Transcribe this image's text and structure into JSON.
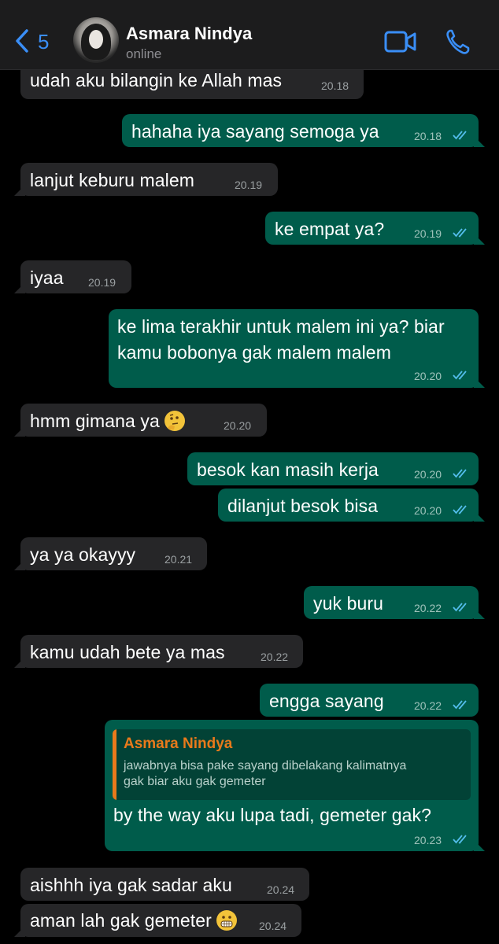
{
  "header": {
    "back_count": "5",
    "contact_name": "Asmara Nindya",
    "status": "online"
  },
  "colors": {
    "accent": "#3a8ef6",
    "outgoing": "#005c4b",
    "incoming": "#262628",
    "quote_name": "#e97a1b"
  },
  "messages": [
    {
      "text": "udah aku bilangin ke Allah mas",
      "time": "20.18",
      "dir": "in"
    },
    {
      "text": "hahaha iya sayang semoga ya",
      "time": "20.18",
      "dir": "out",
      "status": "read"
    },
    {
      "text": "lanjut keburu malem",
      "time": "20.19",
      "dir": "in"
    },
    {
      "text": "ke empat ya?",
      "time": "20.19",
      "dir": "out",
      "status": "read"
    },
    {
      "text": "iyaa",
      "time": "20.19",
      "dir": "in"
    },
    {
      "text_line1": "ke lima terakhir untuk malem ini ya? biar",
      "text_line2": "kamu bobonya gak malem malem",
      "time": "20.20",
      "dir": "out",
      "status": "read"
    },
    {
      "text": "hmm gimana ya",
      "emoji": "thinking-face-emoji",
      "time": "20.20",
      "dir": "in"
    },
    {
      "text": "besok kan masih kerja",
      "time": "20.20",
      "dir": "out",
      "status": "read"
    },
    {
      "text": "dilanjut besok bisa",
      "time": "20.20",
      "dir": "out",
      "status": "read"
    },
    {
      "text": "ya ya okayyy",
      "time": "20.21",
      "dir": "in"
    },
    {
      "text": "yuk buru",
      "time": "20.22",
      "dir": "out",
      "status": "read"
    },
    {
      "text": "kamu udah bete ya mas",
      "time": "20.22",
      "dir": "in"
    },
    {
      "text": "engga sayang",
      "time": "20.22",
      "dir": "out",
      "status": "read"
    },
    {
      "quote_name": "Asmara Nindya",
      "quote_line1": "jawabnya bisa pake sayang dibelakang kalimatnya",
      "quote_line2": "gak biar aku gak gemeter",
      "text": "by the way aku lupa tadi, gemeter gak?",
      "time": "20.23",
      "dir": "out",
      "status": "read"
    },
    {
      "text": "aishhh iya gak sadar aku",
      "time": "20.24",
      "dir": "in"
    },
    {
      "text": "aman lah gak gemeter",
      "emoji": "grimacing-face-emoji",
      "time": "20.24",
      "dir": "in"
    }
  ]
}
